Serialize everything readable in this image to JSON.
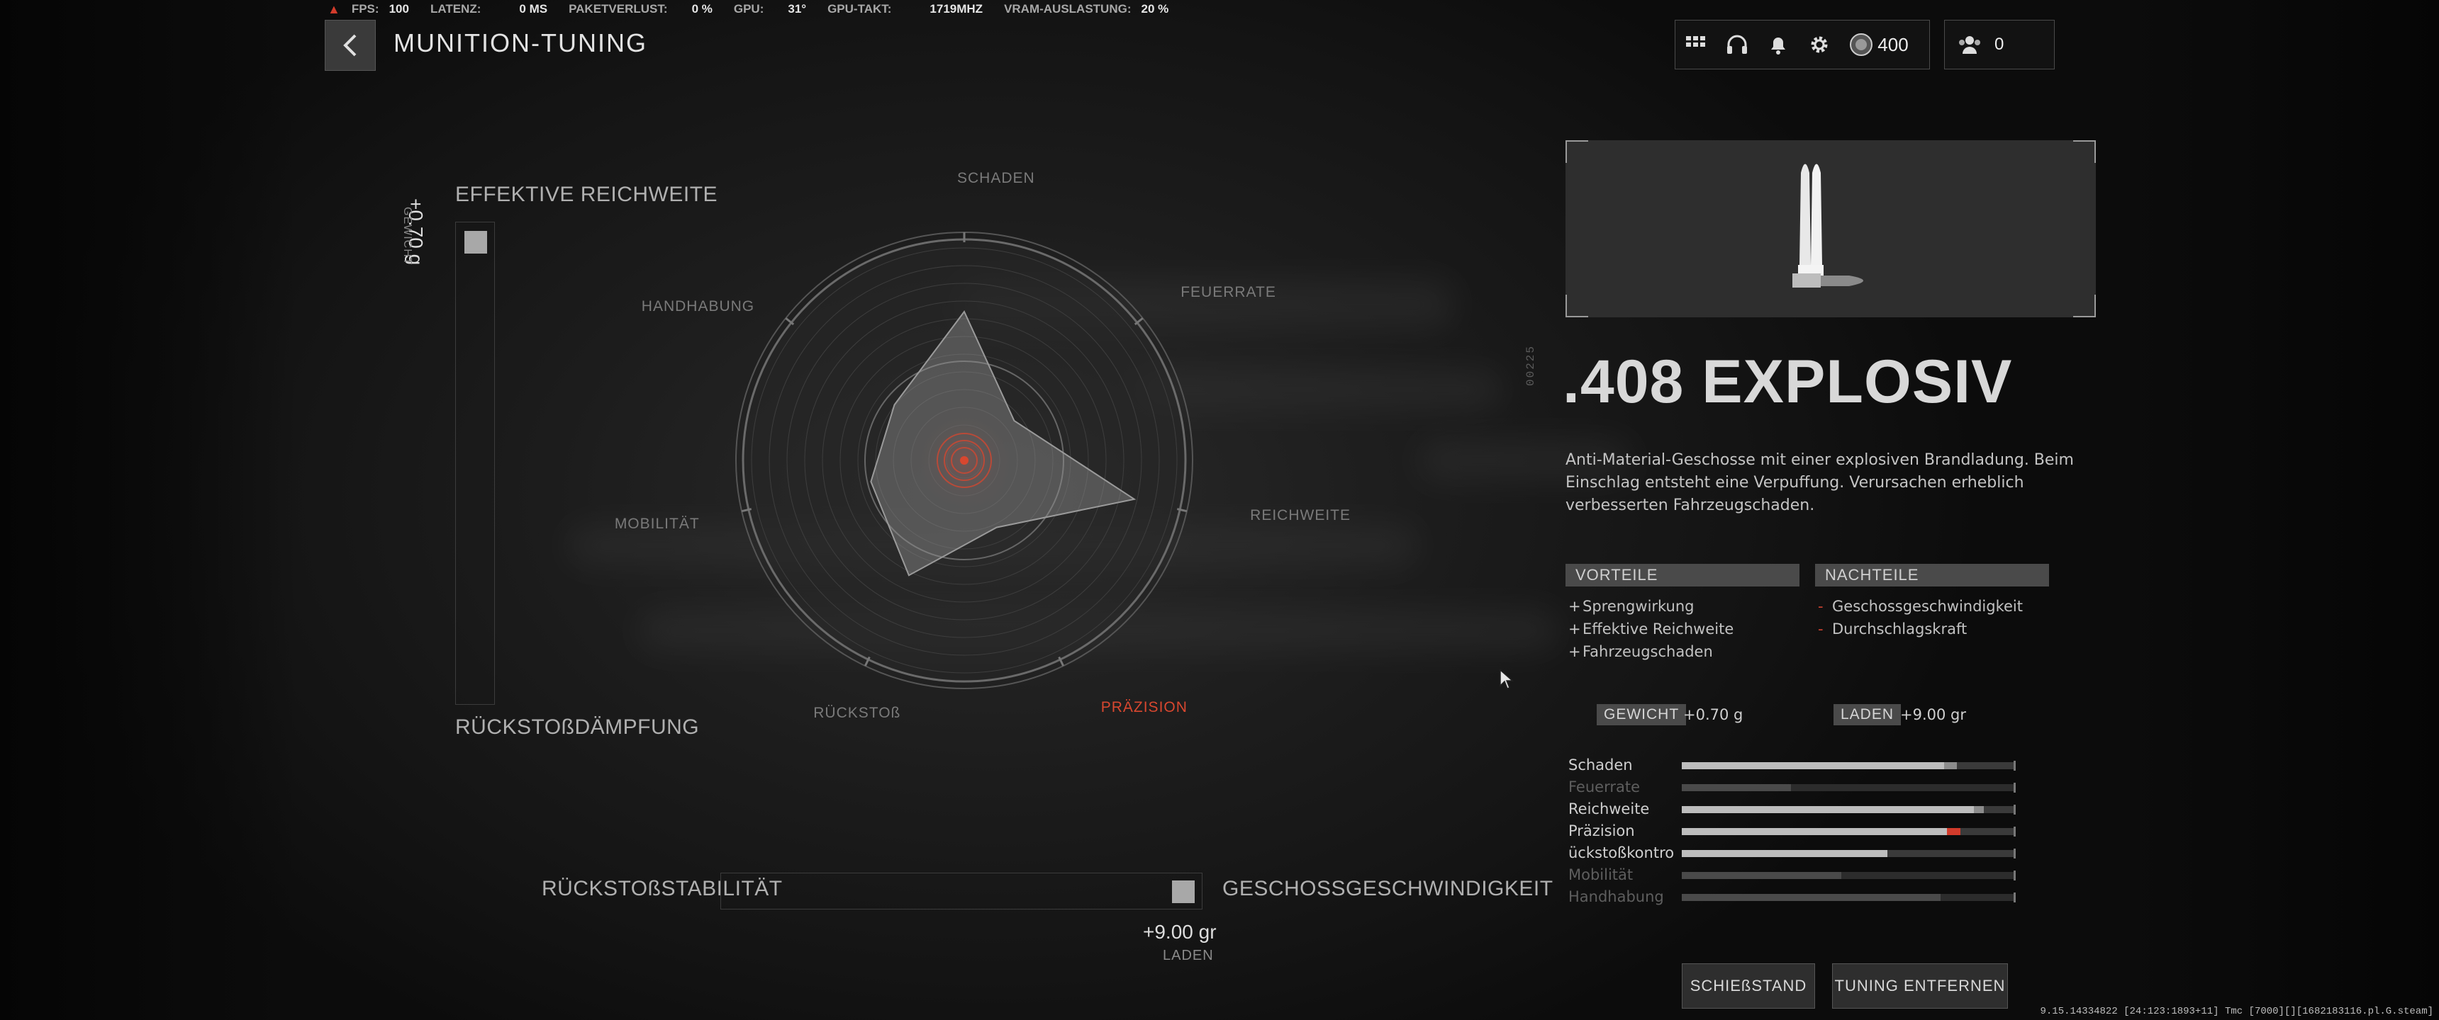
{
  "perf": {
    "fps_label": "FPS:",
    "fps": "100",
    "latency_label": "LATENZ:",
    "latency": "0 MS",
    "packetloss_label": "PAKETVERLUST:",
    "packetloss": "0 %",
    "gpu_label": "GPU:",
    "gpu": "31°",
    "gpuclock_label": "GPU-TAKT:",
    "gpuclock": "1719MHZ",
    "vram_label": "VRAM-AUSLASTUNG:",
    "vram": "20 %"
  },
  "header": {
    "title": "MUNITION-TUNING",
    "cp_amount": "400",
    "party_count": "0"
  },
  "tuning": {
    "vertical": {
      "top_label": "EFFEKTIVE REICHWEITE",
      "bottom_label": "RÜCKSTOßDÄMPFUNG",
      "value": "+0.70 g",
      "value_label": "GEWICHT",
      "position": 0.0
    },
    "horizontal": {
      "left_label": "RÜCKSTOßSTABILITÄT",
      "right_label": "GESCHOSSGESCHWINDIGKEIT",
      "value": "+9.00 gr",
      "value_label": "LADEN",
      "position": 1.0
    }
  },
  "radar": {
    "axes": [
      {
        "name": "SCHADEN",
        "value": 0.7
      },
      {
        "name": "FEUERRATE",
        "value": 0.3
      },
      {
        "name": "REICHWEITE",
        "value": 0.82
      },
      {
        "name": "PRÄZISION",
        "value": 0.35
      },
      {
        "name": "RÜCKSTOß",
        "value": 0.6
      },
      {
        "name": "MOBILITÄT",
        "value": 0.45
      },
      {
        "name": "HANDHABUNG",
        "value": 0.42
      }
    ],
    "highlight_color": "#d8472f"
  },
  "ammo": {
    "side_code": "00225",
    "name": ".408 EXPLOSIV",
    "description": "Anti-Material-Geschosse mit einer explosiven Brandladung. Beim Einschlag entsteht eine Verpuffung. Verursachen erheblich verbesserten Fahrzeugschaden.",
    "pros_header": "VORTEILE",
    "cons_header": "NACHTEILE",
    "pros": [
      "Sprengwirkung",
      "Effektive Reichweite",
      "Fahrzeugschaden"
    ],
    "cons": [
      "Geschossgeschwindigkeit",
      "Durchschlagskraft"
    ],
    "pro_mark": "+",
    "con_mark": "-",
    "weight_label": "GEWICHT",
    "weight_value": "+0.70  g",
    "load_label": "LADEN",
    "load_value": "+9.00  gr"
  },
  "stats": [
    {
      "name": "Schaden",
      "base": 0.79,
      "mod": 0.04,
      "mod_color": "#8c8c8c",
      "active": true
    },
    {
      "name": "Feuerrate",
      "base": 0.33,
      "mod": 0,
      "mod_color": "#8c8c8c",
      "active": false
    },
    {
      "name": "Reichweite",
      "base": 0.88,
      "mod": 0.03,
      "mod_color": "#8c8c8c",
      "active": true
    },
    {
      "name": "Präzision",
      "base": 0.8,
      "mod": 0.04,
      "mod_color": "#d23b2b",
      "active": true
    },
    {
      "name": "ückstoßkontrol",
      "base": 0.62,
      "mod": 0,
      "mod_color": "#8c8c8c",
      "active": true
    },
    {
      "name": "Mobilität",
      "base": 0.48,
      "mod": 0,
      "mod_color": "#8c8c8c",
      "active": false
    },
    {
      "name": "Handhabung",
      "base": 0.78,
      "mod": 0,
      "mod_color": "#8c8c8c",
      "active": false
    }
  ],
  "buttons": {
    "range": "SCHIEßSTAND",
    "remove_tuning": "TUNING ENTFERNEN"
  },
  "version": "9.15.14334822 [24:123:1893+11] Tmc [7000][][1682183116.pl.G.steam]"
}
